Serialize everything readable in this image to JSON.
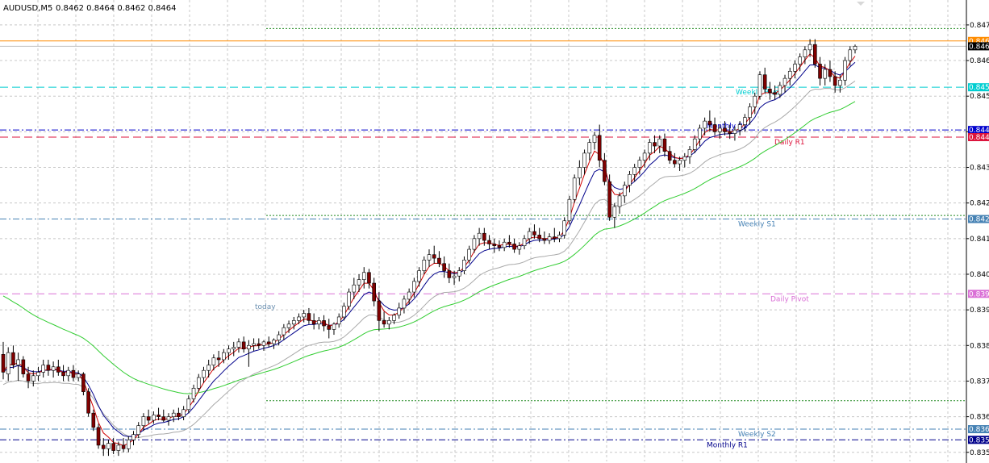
{
  "header": {
    "symbol": "AUDUSD,M5",
    "quote": "0.8462 0.8464 0.8462 0.8464"
  },
  "chart_data": {
    "type": "candlestick",
    "ylim": [
      0.8347,
      0.8477
    ],
    "y_ticks": [
      "0.847",
      "0.846",
      "0.845",
      "0.844",
      "0.843",
      "0.842",
      "0.841",
      "0.840",
      "0.839",
      "0.838",
      "0.837",
      "0.836",
      "0.835"
    ],
    "y_tick_values": [
      0.847,
      0.846,
      0.845,
      0.844,
      0.843,
      0.842,
      0.841,
      0.84,
      0.839,
      0.838,
      0.837,
      0.836,
      0.835
    ],
    "grid": true,
    "colors": {
      "bull": "#006400",
      "bear": "#800000",
      "ema_fast": "#d00000",
      "ema_mid": "#00008b",
      "ema_slow": "#a9a9a9",
      "sma_long": "#32cd32"
    },
    "levels": [
      {
        "name": "orange-line",
        "value": 0.84655,
        "color": "#ff8c00",
        "style": "solid",
        "tag": "0.846",
        "label": ""
      },
      {
        "name": "weekly-pivot",
        "value": 0.84525,
        "color": "#00ced1",
        "style": "dash",
        "tag": "0.845",
        "label": "Weekly Pivot"
      },
      {
        "name": "monthly-r2",
        "value": 0.84405,
        "color": "#0000cd",
        "style": "dashdot",
        "tag": "0.844",
        "label": "Monthly R2"
      },
      {
        "name": "daily-r1",
        "value": 0.84385,
        "color": "#dc143c",
        "style": "dash",
        "tag": "0.844",
        "label": "Daily R1"
      },
      {
        "name": "weekly-s1",
        "value": 0.84155,
        "color": "#4682b4",
        "style": "dashdot",
        "tag": "0.842",
        "label": "Weekly S1"
      },
      {
        "name": "daily-pivot",
        "value": 0.83945,
        "color": "#da70d6",
        "style": "dash",
        "tag": "0.839",
        "label": "Daily Pivot"
      },
      {
        "name": "weekly-s2",
        "value": 0.83565,
        "color": "#4682b4",
        "style": "dashdot",
        "tag": "0.836",
        "label": "Weekly S2"
      },
      {
        "name": "monthly-r1",
        "value": 0.83535,
        "color": "#00008b",
        "style": "dashdot",
        "tag": "0.835",
        "label": "Monthly R1"
      }
    ],
    "session_lines": [
      {
        "value": 0.8469,
        "color": "#228b22"
      },
      {
        "value": 0.84165,
        "color": "#228b22"
      },
      {
        "value": 0.83645,
        "color": "#228b22"
      }
    ],
    "annotation": "today",
    "last_price": {
      "value": 0.8464,
      "tag": "0.846"
    },
    "candles": [
      [
        0.83775,
        0.8381,
        0.83705,
        0.83725
      ],
      [
        0.8372,
        0.83795,
        0.837,
        0.8378
      ],
      [
        0.8378,
        0.838,
        0.83735,
        0.83745
      ],
      [
        0.83745,
        0.8378,
        0.837,
        0.8376
      ],
      [
        0.8376,
        0.8377,
        0.8371,
        0.8372
      ],
      [
        0.8372,
        0.8374,
        0.8368,
        0.837
      ],
      [
        0.837,
        0.8373,
        0.83685,
        0.83715
      ],
      [
        0.83715,
        0.8374,
        0.837,
        0.83725
      ],
      [
        0.83725,
        0.8376,
        0.8371,
        0.83745
      ],
      [
        0.83745,
        0.8376,
        0.83715,
        0.8373
      ],
      [
        0.8373,
        0.83755,
        0.8371,
        0.8374
      ],
      [
        0.8374,
        0.8376,
        0.83715,
        0.83725
      ],
      [
        0.83725,
        0.83745,
        0.837,
        0.83715
      ],
      [
        0.83715,
        0.8374,
        0.837,
        0.8373
      ],
      [
        0.8373,
        0.83745,
        0.837,
        0.8371
      ],
      [
        0.8371,
        0.8373,
        0.837,
        0.8372
      ],
      [
        0.8372,
        0.83725,
        0.8366,
        0.8367
      ],
      [
        0.8367,
        0.8368,
        0.836,
        0.8361
      ],
      [
        0.8361,
        0.8362,
        0.8356,
        0.8357
      ],
      [
        0.8357,
        0.8358,
        0.8351,
        0.8352
      ],
      [
        0.8352,
        0.8354,
        0.8349,
        0.8351
      ],
      [
        0.8351,
        0.83535,
        0.8349,
        0.83525
      ],
      [
        0.83525,
        0.8354,
        0.83495,
        0.83505
      ],
      [
        0.83505,
        0.8353,
        0.8349,
        0.8352
      ],
      [
        0.8352,
        0.8354,
        0.835,
        0.8351
      ],
      [
        0.8351,
        0.83545,
        0.835,
        0.83535
      ],
      [
        0.83535,
        0.8356,
        0.8352,
        0.8355
      ],
      [
        0.8355,
        0.83585,
        0.8354,
        0.83575
      ],
      [
        0.83575,
        0.8361,
        0.8356,
        0.836
      ],
      [
        0.836,
        0.8362,
        0.8358,
        0.8359
      ],
      [
        0.8359,
        0.83615,
        0.8358,
        0.83605
      ],
      [
        0.83605,
        0.83625,
        0.8359,
        0.836
      ],
      [
        0.836,
        0.8362,
        0.83585,
        0.8359
      ],
      [
        0.8359,
        0.8361,
        0.83575,
        0.836
      ],
      [
        0.836,
        0.8362,
        0.83585,
        0.8361
      ],
      [
        0.8361,
        0.83625,
        0.8359,
        0.836
      ],
      [
        0.836,
        0.8363,
        0.8359,
        0.8362
      ],
      [
        0.8362,
        0.8366,
        0.8361,
        0.8365
      ],
      [
        0.8365,
        0.8369,
        0.8364,
        0.8368
      ],
      [
        0.8368,
        0.8372,
        0.8367,
        0.8371
      ],
      [
        0.8371,
        0.8374,
        0.83695,
        0.8373
      ],
      [
        0.8373,
        0.8376,
        0.8371,
        0.83745
      ],
      [
        0.83745,
        0.83775,
        0.8373,
        0.83765
      ],
      [
        0.83765,
        0.83785,
        0.8374,
        0.8376
      ],
      [
        0.8376,
        0.8379,
        0.8375,
        0.8378
      ],
      [
        0.8378,
        0.838,
        0.8376,
        0.8379
      ],
      [
        0.8379,
        0.8381,
        0.8377,
        0.83795
      ],
      [
        0.83795,
        0.8382,
        0.8378,
        0.8381
      ],
      [
        0.8381,
        0.83825,
        0.8378,
        0.8379
      ],
      [
        0.8379,
        0.83815,
        0.8374,
        0.838
      ],
      [
        0.838,
        0.8382,
        0.83785,
        0.83805
      ],
      [
        0.83805,
        0.8382,
        0.8379,
        0.838
      ],
      [
        0.838,
        0.83815,
        0.83785,
        0.8381
      ],
      [
        0.8381,
        0.83825,
        0.83795,
        0.83805
      ],
      [
        0.83805,
        0.8382,
        0.8379,
        0.83815
      ],
      [
        0.83815,
        0.8384,
        0.838,
        0.8383
      ],
      [
        0.8383,
        0.8386,
        0.83815,
        0.8385
      ],
      [
        0.8385,
        0.8387,
        0.83835,
        0.8386
      ],
      [
        0.8386,
        0.8388,
        0.83845,
        0.8387
      ],
      [
        0.8387,
        0.8389,
        0.8386,
        0.8388
      ],
      [
        0.8388,
        0.839,
        0.83865,
        0.8389
      ],
      [
        0.8389,
        0.83905,
        0.8386,
        0.8387
      ],
      [
        0.8387,
        0.8389,
        0.83845,
        0.8386
      ],
      [
        0.8386,
        0.8388,
        0.83845,
        0.8387
      ],
      [
        0.8387,
        0.83885,
        0.8384,
        0.83855
      ],
      [
        0.83855,
        0.83875,
        0.8382,
        0.83845
      ],
      [
        0.83845,
        0.83865,
        0.8383,
        0.8386
      ],
      [
        0.8386,
        0.8389,
        0.8385,
        0.8388
      ],
      [
        0.8388,
        0.8392,
        0.8387,
        0.8391
      ],
      [
        0.8391,
        0.8396,
        0.839,
        0.8395
      ],
      [
        0.8395,
        0.8399,
        0.8393,
        0.8397
      ],
      [
        0.8397,
        0.84,
        0.8395,
        0.83985
      ],
      [
        0.83985,
        0.8402,
        0.8396,
        0.84005
      ],
      [
        0.84005,
        0.84015,
        0.8396,
        0.83975
      ],
      [
        0.83975,
        0.8399,
        0.8391,
        0.83925
      ],
      [
        0.83925,
        0.8395,
        0.8384,
        0.8387
      ],
      [
        0.8387,
        0.83895,
        0.8385,
        0.8386
      ],
      [
        0.8386,
        0.8388,
        0.83845,
        0.8387
      ],
      [
        0.8387,
        0.8389,
        0.8386,
        0.83885
      ],
      [
        0.83885,
        0.8392,
        0.83875,
        0.83905
      ],
      [
        0.83905,
        0.8394,
        0.8389,
        0.8393
      ],
      [
        0.8393,
        0.8396,
        0.83915,
        0.8395
      ],
      [
        0.8395,
        0.8399,
        0.83935,
        0.8398
      ],
      [
        0.8398,
        0.8402,
        0.83965,
        0.8401
      ],
      [
        0.8401,
        0.8405,
        0.84,
        0.8404
      ],
      [
        0.8404,
        0.8407,
        0.8402,
        0.84055
      ],
      [
        0.84055,
        0.8408,
        0.8403,
        0.84045
      ],
      [
        0.84045,
        0.84065,
        0.8402,
        0.8403
      ],
      [
        0.8403,
        0.8405,
        0.8399,
        0.8401
      ],
      [
        0.8401,
        0.8403,
        0.83975,
        0.8399
      ],
      [
        0.8399,
        0.8401,
        0.8397,
        0.83995
      ],
      [
        0.83995,
        0.8402,
        0.8398,
        0.8401
      ],
      [
        0.8401,
        0.8405,
        0.84,
        0.8404
      ],
      [
        0.8404,
        0.8408,
        0.8403,
        0.8407
      ],
      [
        0.8407,
        0.8411,
        0.8406,
        0.841
      ],
      [
        0.841,
        0.8413,
        0.8408,
        0.84115
      ],
      [
        0.84115,
        0.8413,
        0.8408,
        0.84095
      ],
      [
        0.84095,
        0.8411,
        0.8407,
        0.84085
      ],
      [
        0.84085,
        0.841,
        0.8406,
        0.8408
      ],
      [
        0.8408,
        0.84095,
        0.84065,
        0.84075
      ],
      [
        0.84075,
        0.841,
        0.84065,
        0.8409
      ],
      [
        0.8409,
        0.8411,
        0.84075,
        0.84085
      ],
      [
        0.84085,
        0.841,
        0.8406,
        0.8407
      ],
      [
        0.8407,
        0.8409,
        0.84055,
        0.8408
      ],
      [
        0.8408,
        0.8411,
        0.8407,
        0.841
      ],
      [
        0.841,
        0.8413,
        0.84085,
        0.8412
      ],
      [
        0.8412,
        0.8414,
        0.841,
        0.8411
      ],
      [
        0.8411,
        0.8413,
        0.8409,
        0.841
      ],
      [
        0.841,
        0.8412,
        0.84085,
        0.84095
      ],
      [
        0.84095,
        0.84115,
        0.84085,
        0.84105
      ],
      [
        0.84105,
        0.8413,
        0.8409,
        0.841
      ],
      [
        0.841,
        0.8412,
        0.8409,
        0.8411
      ],
      [
        0.8411,
        0.8416,
        0.841,
        0.8415
      ],
      [
        0.8415,
        0.8422,
        0.8414,
        0.8421
      ],
      [
        0.8421,
        0.8428,
        0.842,
        0.8427
      ],
      [
        0.8427,
        0.8432,
        0.8425,
        0.843
      ],
      [
        0.843,
        0.8435,
        0.8428,
        0.8434
      ],
      [
        0.8434,
        0.8438,
        0.8432,
        0.8437
      ],
      [
        0.8437,
        0.844,
        0.8435,
        0.8439
      ],
      [
        0.8439,
        0.8442,
        0.843,
        0.8432
      ],
      [
        0.8432,
        0.8434,
        0.8425,
        0.8426
      ],
      [
        0.8426,
        0.8428,
        0.8415,
        0.8416
      ],
      [
        0.8416,
        0.842,
        0.8413,
        0.8419
      ],
      [
        0.8419,
        0.8423,
        0.8417,
        0.8422
      ],
      [
        0.8422,
        0.8426,
        0.842,
        0.8425
      ],
      [
        0.8425,
        0.8429,
        0.8423,
        0.8428
      ],
      [
        0.8428,
        0.8431,
        0.8426,
        0.843
      ],
      [
        0.843,
        0.8433,
        0.8428,
        0.8432
      ],
      [
        0.8432,
        0.8435,
        0.843,
        0.8434
      ],
      [
        0.8434,
        0.8438,
        0.8432,
        0.8437
      ],
      [
        0.8437,
        0.8439,
        0.8434,
        0.8436
      ],
      [
        0.8436,
        0.8439,
        0.8434,
        0.8438
      ],
      [
        0.8438,
        0.84395,
        0.8433,
        0.84345
      ],
      [
        0.84345,
        0.8436,
        0.8431,
        0.8432
      ],
      [
        0.8432,
        0.8434,
        0.843,
        0.8431
      ],
      [
        0.8431,
        0.8433,
        0.8429,
        0.8432
      ],
      [
        0.8432,
        0.8434,
        0.843,
        0.8433
      ],
      [
        0.8433,
        0.8436,
        0.8431,
        0.8435
      ],
      [
        0.8435,
        0.8439,
        0.8434,
        0.8438
      ],
      [
        0.8438,
        0.8442,
        0.8436,
        0.8441
      ],
      [
        0.8441,
        0.8444,
        0.8439,
        0.8443
      ],
      [
        0.8443,
        0.8446,
        0.844,
        0.8442
      ],
      [
        0.8442,
        0.8444,
        0.8439,
        0.844
      ],
      [
        0.844,
        0.8442,
        0.8438,
        0.8441
      ],
      [
        0.8441,
        0.8443,
        0.8439,
        0.844
      ],
      [
        0.844,
        0.8442,
        0.8438,
        0.84395
      ],
      [
        0.84395,
        0.84415,
        0.84375,
        0.84405
      ],
      [
        0.84405,
        0.8443,
        0.8439,
        0.8442
      ],
      [
        0.8442,
        0.8445,
        0.844,
        0.8444
      ],
      [
        0.8444,
        0.8448,
        0.8442,
        0.8447
      ],
      [
        0.8447,
        0.8451,
        0.8445,
        0.845
      ],
      [
        0.845,
        0.8457,
        0.8449,
        0.8456
      ],
      [
        0.8456,
        0.8458,
        0.8451,
        0.8452
      ],
      [
        0.8452,
        0.8454,
        0.8449,
        0.8451
      ],
      [
        0.8451,
        0.8453,
        0.8449,
        0.84505
      ],
      [
        0.84505,
        0.8454,
        0.84495,
        0.8453
      ],
      [
        0.8453,
        0.8456,
        0.8451,
        0.8455
      ],
      [
        0.8455,
        0.8458,
        0.8453,
        0.8457
      ],
      [
        0.8457,
        0.846,
        0.8455,
        0.8459
      ],
      [
        0.8459,
        0.8462,
        0.8457,
        0.8461
      ],
      [
        0.8461,
        0.8464,
        0.8459,
        0.8463
      ],
      [
        0.8463,
        0.8466,
        0.8461,
        0.84645
      ],
      [
        0.84645,
        0.8466,
        0.8458,
        0.8459
      ],
      [
        0.8459,
        0.8461,
        0.8453,
        0.8455
      ],
      [
        0.8455,
        0.8459,
        0.8453,
        0.84575
      ],
      [
        0.84575,
        0.846,
        0.8454,
        0.84555
      ],
      [
        0.84555,
        0.8457,
        0.8451,
        0.8453
      ],
      [
        0.8453,
        0.8456,
        0.8451,
        0.84545
      ],
      [
        0.84545,
        0.8461,
        0.8453,
        0.846
      ],
      [
        0.846,
        0.8464,
        0.84585,
        0.8463
      ],
      [
        0.8463,
        0.84645,
        0.8462,
        0.8464
      ]
    ]
  }
}
